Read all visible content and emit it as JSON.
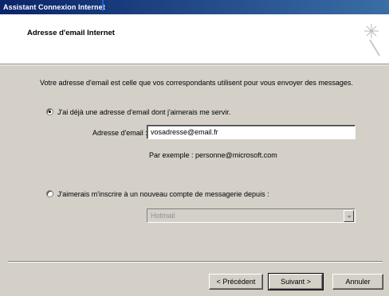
{
  "window": {
    "title": "Assistant Connexion Internet"
  },
  "header": {
    "title": "Adresse d'email Internet",
    "icon": "wizard-wand-icon"
  },
  "description": "Votre adresse d'email est celle que vos correspondants utilisent pour vous envoyer des messages.",
  "options": {
    "existing_label": "J'ai déjà une adresse d'email dont j'aimerais me servir.",
    "existing_selected": true,
    "email_label": "Adresse d'email :",
    "email_value": "vosadresse@email.fr",
    "example_text": "Par exemple : personne@microsoft.com",
    "new_account_label": "J'aimerais m'inscrire à un nouveau compte de messagerie depuis :",
    "new_account_selected": false,
    "provider_value": "Hotmail"
  },
  "buttons": {
    "back": "< Précédent",
    "next": "Suivant >",
    "cancel": "Annuler"
  }
}
